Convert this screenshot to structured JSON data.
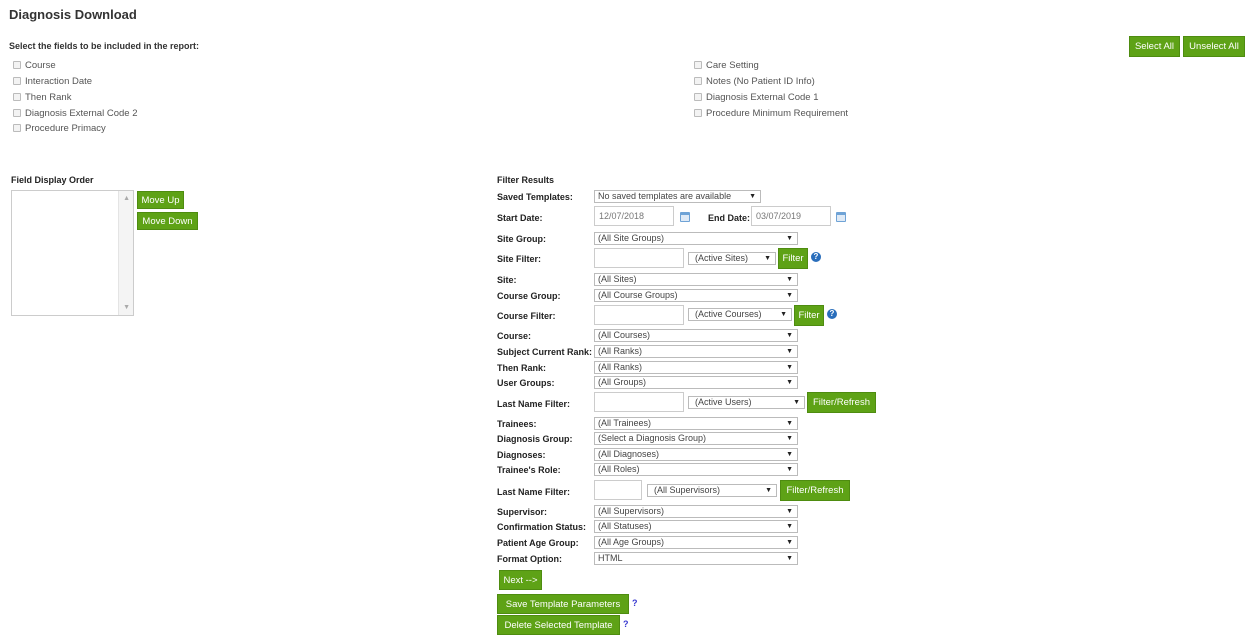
{
  "page": {
    "title": "Diagnosis Download",
    "instructions": "Select the fields to be included in the report:",
    "select_all": "Select All",
    "unselect_all": "Unselect All"
  },
  "fields": {
    "left": [
      "Course",
      "Interaction Date",
      "Then Rank",
      "Diagnosis External Code 2",
      "Procedure Primacy"
    ],
    "right": [
      "Care Setting",
      "Notes (No Patient ID Info)",
      "Diagnosis External Code 1",
      "Procedure Minimum Requirement"
    ]
  },
  "order": {
    "label": "Field Display Order",
    "move_up": "Move Up",
    "move_down": "Move Down"
  },
  "filter": {
    "heading": "Filter Results",
    "saved_templates_label": "Saved Templates:",
    "saved_templates_value": "No saved templates are available",
    "start_date_label": "Start Date:",
    "start_date_value": "12/07/2018",
    "end_date_label": "End Date:",
    "end_date_value": "03/07/2019",
    "site_group_label": "Site Group:",
    "site_group_value": "(All Site Groups)",
    "site_filter_label": "Site Filter:",
    "site_filter_select": "(Active Sites)",
    "filter_btn": "Filter",
    "site_label": "Site:",
    "site_value": "(All Sites)",
    "course_group_label": "Course Group:",
    "course_group_value": "(All Course Groups)",
    "course_filter_label": "Course Filter:",
    "course_filter_select": "(Active Courses)",
    "course_label": "Course:",
    "course_value": "(All Courses)",
    "subject_rank_label": "Subject Current Rank:",
    "subject_rank_value": "(All Ranks)",
    "then_rank_label": "Then Rank:",
    "then_rank_value": "(All Ranks)",
    "user_groups_label": "User Groups:",
    "user_groups_value": "(All Groups)",
    "last_name_label": "Last Name Filter:",
    "users_select": "(Active Users)",
    "filter_refresh": "Filter/Refresh",
    "trainees_label": "Trainees:",
    "trainees_value": "(All Trainees)",
    "diag_group_label": "Diagnosis Group:",
    "diag_group_value": "(Select a Diagnosis Group)",
    "diagnoses_label": "Diagnoses:",
    "diagnoses_value": "(All Diagnoses)",
    "trainee_role_label": "Trainee's Role:",
    "trainee_role_value": "(All Roles)",
    "last_name_label_2": "Last Name Filter:",
    "supervisors_select": "(All Supervisors)",
    "supervisor_label": "Supervisor:",
    "supervisor_value": "(All Supervisors)",
    "confirmation_label": "Confirmation Status:",
    "confirmation_value": "(All Statuses)",
    "age_group_label": "Patient Age Group:",
    "age_group_value": "(All Age Groups)",
    "format_label": "Format Option:",
    "format_value": "HTML",
    "next": "Next -->",
    "save_template": "Save Template Parameters",
    "delete_template": "Delete Selected Template",
    "help_mark": "?"
  },
  "colors": {
    "accent": "#5ea216",
    "help": "#2a6ebb"
  }
}
